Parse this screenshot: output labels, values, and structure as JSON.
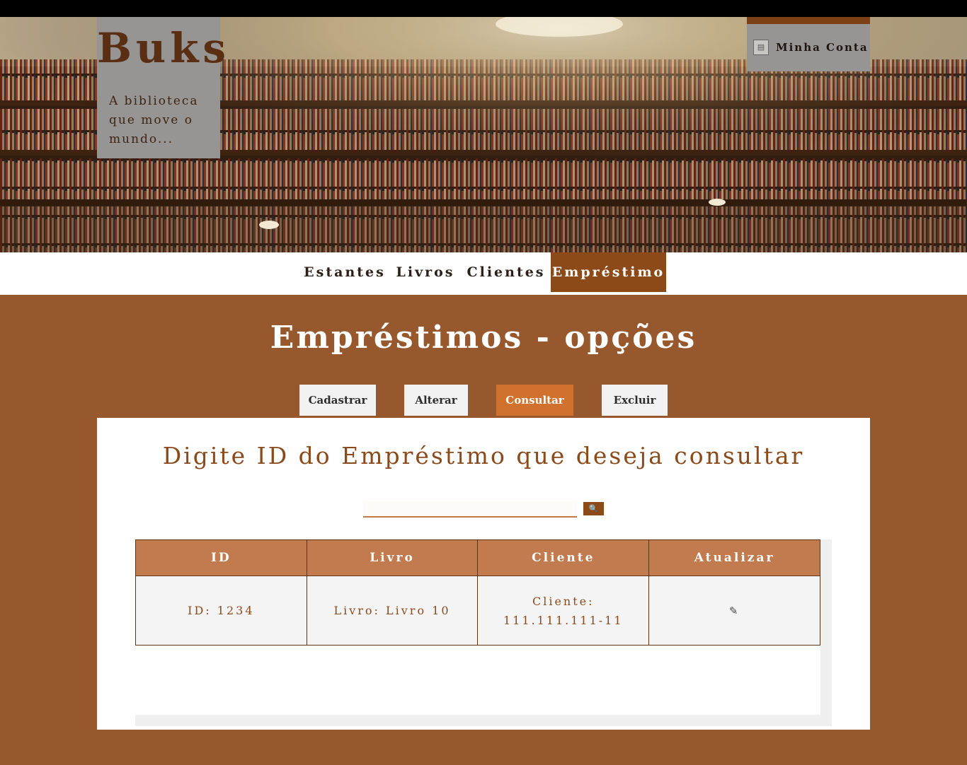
{
  "brand": {
    "title": "Buks",
    "tagline": "A biblioteca que move o mundo..."
  },
  "account": {
    "label": "Minha Conta",
    "icon": "document-icon"
  },
  "nav": {
    "items": [
      {
        "label": "Estantes"
      },
      {
        "label": "Livros"
      },
      {
        "label": "Clientes"
      },
      {
        "label": "Empréstimo",
        "active": true
      }
    ]
  },
  "page": {
    "title": "Empréstimos - opções"
  },
  "options": [
    {
      "label": "Cadastrar"
    },
    {
      "label": "Alterar"
    },
    {
      "label": "Consultar",
      "active": true
    },
    {
      "label": "Excluir"
    }
  ],
  "consult": {
    "heading": "Digite ID do Empréstimo que deseja consultar",
    "search_value": "",
    "search_icon": "search-icon",
    "search_button": "🔍"
  },
  "table": {
    "headers": [
      "ID",
      "Livro",
      "Cliente",
      "Atualizar"
    ],
    "rows": [
      {
        "id": "ID: 1234",
        "livro": "Livro: Livro 10",
        "cliente": "Cliente: 111.111.111-11",
        "atualizar_icon": "✎"
      }
    ]
  },
  "colors": {
    "background": "#96582c",
    "accent": "#8c4a18",
    "active_option": "#d0712e",
    "table_header": "#c17b4f"
  }
}
